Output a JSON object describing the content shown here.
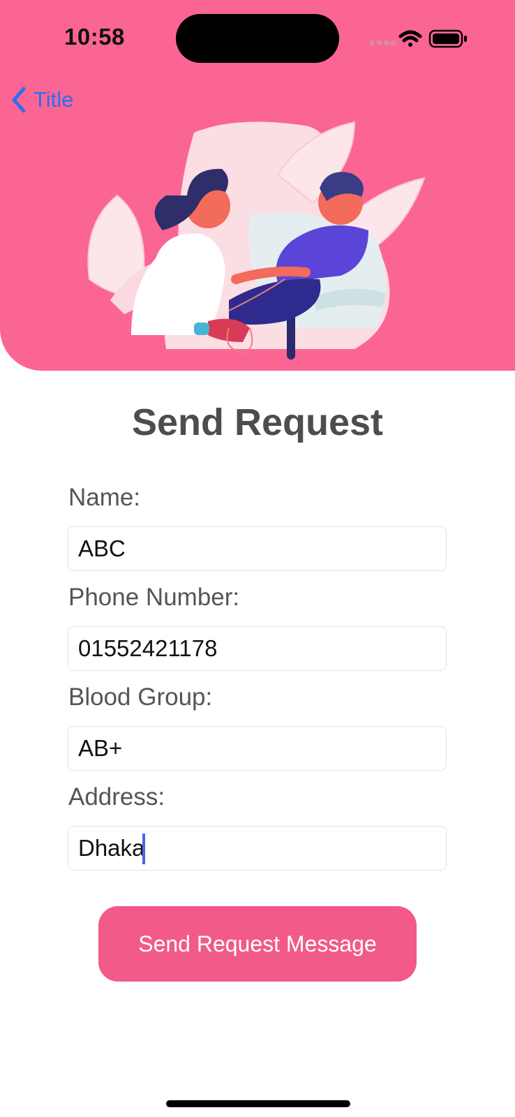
{
  "status_bar": {
    "time": "10:58"
  },
  "nav": {
    "back_label": "Title"
  },
  "page": {
    "title": "Send Request"
  },
  "form": {
    "name_label": "Name:",
    "name_value": "ABC",
    "phone_label": "Phone Number:",
    "phone_value": "01552421178",
    "blood_label": "Blood Group:",
    "blood_value": "AB+",
    "address_label": "Address:",
    "address_value": "Dhaka"
  },
  "actions": {
    "send_label": "Send Request Message"
  },
  "colors": {
    "header_pink": "#fb6593",
    "button_pink": "#f25a8a",
    "link_blue": "#2f6cf6"
  }
}
